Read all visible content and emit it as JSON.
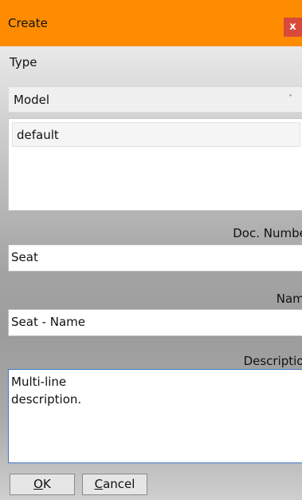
{
  "window": {
    "title": "Create",
    "close_glyph": "x",
    "titlebar_color": "#ff8c00",
    "close_color": "#d94a3b"
  },
  "type": {
    "label": "Type",
    "selected": "Model",
    "chevron_icon": "chevron-down-icon",
    "chevron_glyph": "˅"
  },
  "list": {
    "items": [
      "default"
    ]
  },
  "doc_number": {
    "label": "Doc. Number",
    "value": "Seat"
  },
  "name": {
    "label": "Name",
    "value": "Seat - Name"
  },
  "description": {
    "label": "Description",
    "value": "Multi-line\ndescription.",
    "focus_color": "#3c78c8"
  },
  "buttons": {
    "ok_mnemonic": "O",
    "ok_rest": "K",
    "cancel_mnemonic": "C",
    "cancel_rest": "ancel"
  }
}
